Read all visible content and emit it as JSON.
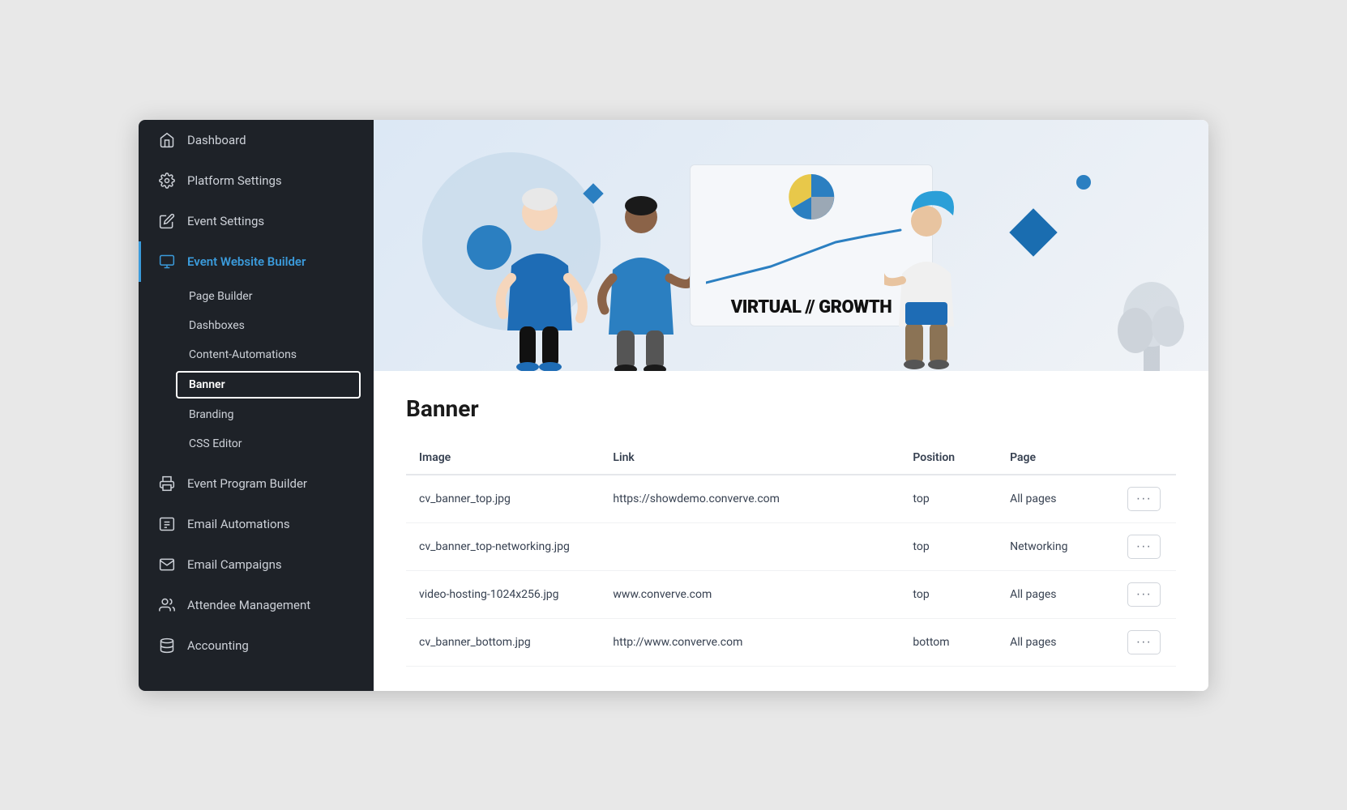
{
  "sidebar": {
    "items": [
      {
        "id": "dashboard",
        "label": "Dashboard",
        "icon": "🏠"
      },
      {
        "id": "platform-settings",
        "label": "Platform Settings",
        "icon": "⚙️"
      },
      {
        "id": "event-settings",
        "label": "Event Settings",
        "icon": "✏️"
      },
      {
        "id": "event-website-builder",
        "label": "Event Website Builder",
        "icon": "🖥",
        "active": true
      },
      {
        "id": "event-program-builder",
        "label": "Event Program Builder",
        "icon": "🖨"
      },
      {
        "id": "email-automations",
        "label": "Email Automations",
        "icon": "📋"
      },
      {
        "id": "email-campaigns",
        "label": "Email Campaigns",
        "icon": "✉️"
      },
      {
        "id": "attendee-management",
        "label": "Attendee Management",
        "icon": "👥"
      },
      {
        "id": "accounting",
        "label": "Accounting",
        "icon": "🗄"
      }
    ],
    "sub_items": [
      {
        "id": "page-builder",
        "label": "Page Builder"
      },
      {
        "id": "dashboxes",
        "label": "Dashboxes"
      },
      {
        "id": "content-automations",
        "label": "Content-Automations"
      },
      {
        "id": "banner",
        "label": "Banner",
        "highlighted": true
      },
      {
        "id": "branding",
        "label": "Branding"
      },
      {
        "id": "css-editor",
        "label": "CSS Editor"
      }
    ]
  },
  "page": {
    "title": "Banner"
  },
  "table": {
    "headers": [
      "Image",
      "Link",
      "Position",
      "Page"
    ],
    "rows": [
      {
        "image": "cv_banner_top.jpg",
        "link": "https://showdemo.converve.com",
        "position": "top",
        "page": "All pages"
      },
      {
        "image": "cv_banner_top-networking.jpg",
        "link": "",
        "position": "top",
        "page": "Networking"
      },
      {
        "image": "video-hosting-1024x256.jpg",
        "link": "www.converve.com",
        "position": "top",
        "page": "All pages"
      },
      {
        "image": "cv_banner_bottom.jpg",
        "link": "http://www.converve.com",
        "position": "bottom",
        "page": "All pages"
      }
    ],
    "action_label": "···"
  },
  "hero": {
    "chart_title": "VIRTUAL // GROWTH"
  },
  "colors": {
    "sidebar_bg": "#1e2228",
    "active_blue": "#3b9bdb",
    "accent_blue": "#2b7fc1"
  }
}
